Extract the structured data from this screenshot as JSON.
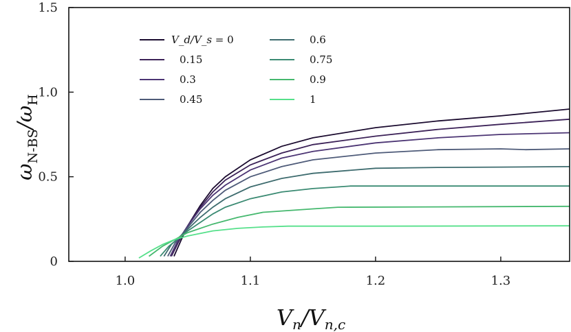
{
  "chart_data": {
    "type": "line",
    "xlabel": "V_n / V_{n,c}",
    "ylabel": "ω_N-BS / ω_H",
    "xlim": [
      0.955,
      1.355
    ],
    "ylim": [
      0,
      1.5
    ],
    "xticks": [
      1.0,
      1.1,
      1.2,
      1.3
    ],
    "xtick_labels": [
      "1.0",
      "1.1",
      "1.2",
      "1.3"
    ],
    "yticks": [
      0,
      0.5,
      1.0,
      1.5
    ],
    "ytick_labels": [
      "0",
      "0.5",
      "1.0",
      "1.5"
    ],
    "grid": false,
    "legend": {
      "placement": "top-left",
      "columns": 2,
      "title_prefix": "V_d/V_s = "
    },
    "series": [
      {
        "name": "0",
        "color": "#1a0a2e",
        "points": [
          [
            1.039,
            0.03
          ],
          [
            1.045,
            0.13
          ],
          [
            1.05,
            0.21
          ],
          [
            1.06,
            0.33
          ],
          [
            1.07,
            0.43
          ],
          [
            1.08,
            0.5
          ],
          [
            1.1,
            0.6
          ],
          [
            1.125,
            0.68
          ],
          [
            1.15,
            0.73
          ],
          [
            1.2,
            0.79
          ],
          [
            1.25,
            0.83
          ],
          [
            1.3,
            0.86
          ],
          [
            1.355,
            0.9
          ]
        ]
      },
      {
        "name": "0.15",
        "color": "#3b2157",
        "points": [
          [
            1.037,
            0.03
          ],
          [
            1.043,
            0.12
          ],
          [
            1.05,
            0.21
          ],
          [
            1.06,
            0.32
          ],
          [
            1.07,
            0.41
          ],
          [
            1.08,
            0.48
          ],
          [
            1.1,
            0.57
          ],
          [
            1.125,
            0.64
          ],
          [
            1.15,
            0.69
          ],
          [
            1.2,
            0.74
          ],
          [
            1.25,
            0.78
          ],
          [
            1.3,
            0.81
          ],
          [
            1.355,
            0.84
          ]
        ]
      },
      {
        "name": "0.3",
        "color": "#4b3473",
        "points": [
          [
            1.036,
            0.03
          ],
          [
            1.042,
            0.12
          ],
          [
            1.05,
            0.21
          ],
          [
            1.06,
            0.31
          ],
          [
            1.07,
            0.39
          ],
          [
            1.08,
            0.45
          ],
          [
            1.1,
            0.54
          ],
          [
            1.125,
            0.61
          ],
          [
            1.15,
            0.65
          ],
          [
            1.2,
            0.7
          ],
          [
            1.25,
            0.73
          ],
          [
            1.3,
            0.75
          ],
          [
            1.355,
            0.76
          ]
        ]
      },
      {
        "name": "0.45",
        "color": "#4d5a78",
        "points": [
          [
            1.034,
            0.03
          ],
          [
            1.04,
            0.11
          ],
          [
            1.05,
            0.2
          ],
          [
            1.06,
            0.29
          ],
          [
            1.07,
            0.36
          ],
          [
            1.08,
            0.42
          ],
          [
            1.1,
            0.5
          ],
          [
            1.125,
            0.56
          ],
          [
            1.15,
            0.6
          ],
          [
            1.2,
            0.64
          ],
          [
            1.25,
            0.66
          ],
          [
            1.3,
            0.665
          ],
          [
            1.32,
            0.66
          ],
          [
            1.355,
            0.665
          ]
        ]
      },
      {
        "name": "0.6",
        "color": "#3d6b6e",
        "points": [
          [
            1.031,
            0.03
          ],
          [
            1.037,
            0.1
          ],
          [
            1.05,
            0.19
          ],
          [
            1.06,
            0.26
          ],
          [
            1.07,
            0.32
          ],
          [
            1.08,
            0.37
          ],
          [
            1.1,
            0.44
          ],
          [
            1.125,
            0.49
          ],
          [
            1.15,
            0.52
          ],
          [
            1.2,
            0.55
          ],
          [
            1.25,
            0.555
          ],
          [
            1.3,
            0.557
          ],
          [
            1.355,
            0.56
          ]
        ]
      },
      {
        "name": "0.75",
        "color": "#3a8a72",
        "points": [
          [
            1.028,
            0.03
          ],
          [
            1.035,
            0.09
          ],
          [
            1.05,
            0.18
          ],
          [
            1.06,
            0.23
          ],
          [
            1.07,
            0.28
          ],
          [
            1.08,
            0.32
          ],
          [
            1.1,
            0.37
          ],
          [
            1.125,
            0.41
          ],
          [
            1.15,
            0.43
          ],
          [
            1.17,
            0.44
          ],
          [
            1.18,
            0.445
          ],
          [
            1.25,
            0.445
          ],
          [
            1.355,
            0.445
          ]
        ]
      },
      {
        "name": "0.9",
        "color": "#45b86e",
        "points": [
          [
            1.019,
            0.03
          ],
          [
            1.03,
            0.09
          ],
          [
            1.04,
            0.13
          ],
          [
            1.05,
            0.17
          ],
          [
            1.07,
            0.22
          ],
          [
            1.09,
            0.26
          ],
          [
            1.11,
            0.29
          ],
          [
            1.13,
            0.3
          ],
          [
            1.15,
            0.31
          ],
          [
            1.17,
            0.32
          ],
          [
            1.25,
            0.322
          ],
          [
            1.355,
            0.325
          ]
        ]
      },
      {
        "name": "1",
        "color": "#55e08a",
        "points": [
          [
            1.011,
            0.02
          ],
          [
            1.02,
            0.06
          ],
          [
            1.03,
            0.1
          ],
          [
            1.04,
            0.13
          ],
          [
            1.05,
            0.15
          ],
          [
            1.07,
            0.18
          ],
          [
            1.09,
            0.195
          ],
          [
            1.11,
            0.203
          ],
          [
            1.13,
            0.208
          ],
          [
            1.2,
            0.208
          ],
          [
            1.355,
            0.21
          ]
        ]
      }
    ]
  }
}
